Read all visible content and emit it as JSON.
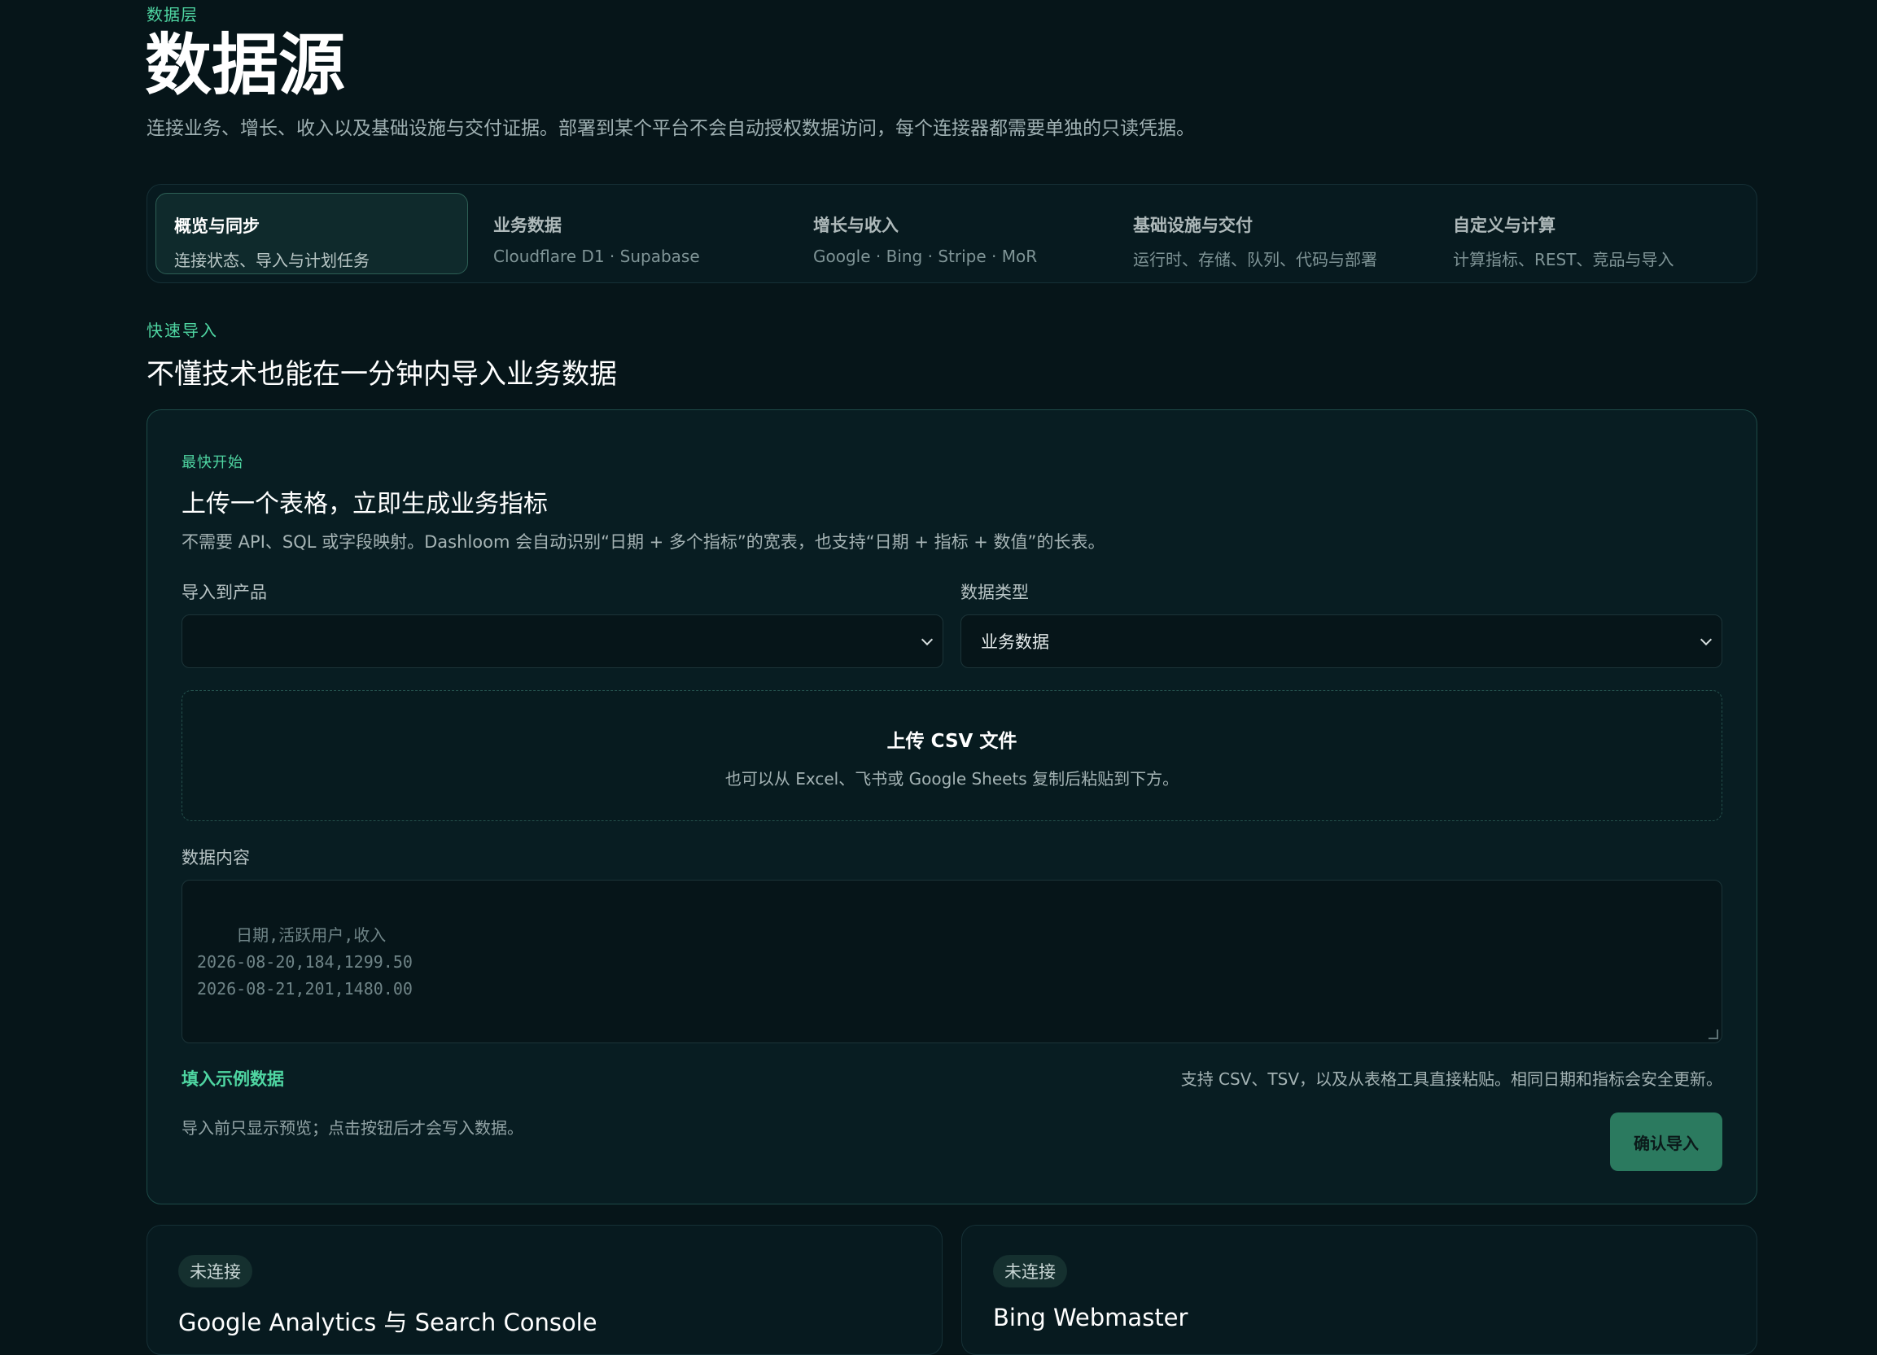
{
  "header": {
    "eyebrow": "数据层",
    "title": "数据源",
    "description": "连接业务、增长、收入以及基础设施与交付证据。部署到某个平台不会自动授权数据访问，每个连接器都需要单独的只读凭据。"
  },
  "tabs": [
    {
      "title": "概览与同步",
      "subtitle": "连接状态、导入与计划任务",
      "active": true
    },
    {
      "title": "业务数据",
      "subtitle": "Cloudflare D1 · Supabase",
      "active": false
    },
    {
      "title": "增长与收入",
      "subtitle": "Google · Bing · Stripe · MoR",
      "active": false
    },
    {
      "title": "基础设施与交付",
      "subtitle": "运行时、存储、队列、代码与部署",
      "active": false
    },
    {
      "title": "自定义与计算",
      "subtitle": "计算指标、REST、竞品与导入",
      "active": false
    }
  ],
  "quick_import": {
    "eyebrow": "快速导入",
    "title": "不懂技术也能在一分钟内导入业务数据"
  },
  "import_card": {
    "eyebrow": "最快开始",
    "title": "上传一个表格，立即生成业务指标",
    "description": "不需要 API、SQL 或字段映射。Dashloom 会自动识别“日期 + 多个指标”的宽表，也支持“日期 + 指标 + 数值”的长表。",
    "product_label": "导入到产品",
    "product_value": "",
    "type_label": "数据类型",
    "type_value": "业务数据",
    "dropzone_title": "上传 CSV 文件",
    "dropzone_subtitle": "也可以从 Excel、飞书或 Google Sheets 复制后粘贴到下方。",
    "content_label": "数据内容",
    "content_placeholder": "日期,活跃用户,收入\n2026-08-20,184,1299.50\n2026-08-21,201,1480.00",
    "sample_link": "填入示例数据",
    "support_hint": "支持 CSV、TSV，以及从表格工具直接粘贴。相同日期和指标会安全更新。",
    "preview_hint": "导入前只显示预览；点击按钮后才会写入数据。",
    "confirm_button": "确认导入"
  },
  "connectors": [
    {
      "status": "未连接",
      "name": "Google Analytics 与 Search Console"
    },
    {
      "status": "未连接",
      "name": "Bing Webmaster"
    }
  ],
  "colors": {
    "background": "#061519",
    "accent": "#4fd6a2",
    "button": "#2b7a5f"
  }
}
